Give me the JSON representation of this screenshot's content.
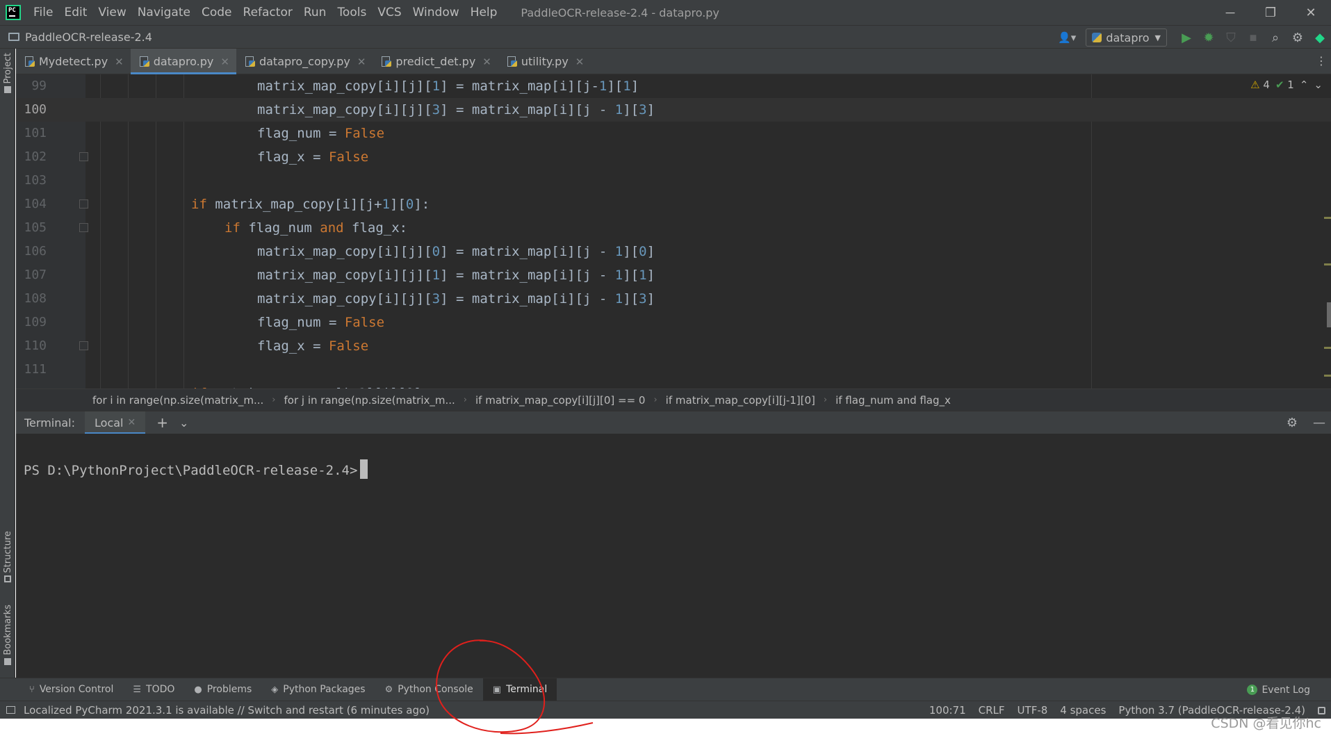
{
  "window": {
    "title": "PaddleOCR-release-2.4 - datapro.py",
    "menu": [
      "File",
      "Edit",
      "View",
      "Navigate",
      "Code",
      "Refactor",
      "Run",
      "Tools",
      "VCS",
      "Window",
      "Help"
    ],
    "controls": {
      "minimize": "─",
      "restore": "❐",
      "close": "✕"
    }
  },
  "navbar": {
    "project": "PaddleOCR-release-2.4",
    "run_config": "datapro"
  },
  "left_stripe": {
    "project": "Project",
    "structure": "Structure",
    "bookmarks": "Bookmarks"
  },
  "tabs": [
    {
      "label": "Mydetect.py",
      "active": false
    },
    {
      "label": "datapro.py",
      "active": true
    },
    {
      "label": "datapro_copy.py",
      "active": false
    },
    {
      "label": "predict_det.py",
      "active": false
    },
    {
      "label": "utility.py",
      "active": false
    }
  ],
  "editor": {
    "inspection": {
      "warnings": "4",
      "ok": "1"
    },
    "current_line": "100",
    "lines": [
      {
        "num": "99",
        "text": "matrix_map_copy[i][j][1] = matrix_map[i][j-1][1]"
      },
      {
        "num": "100",
        "text": "matrix_map_copy[i][j][3] = matrix_map[i][j - 1][3]"
      },
      {
        "num": "101",
        "text": "flag_num = False"
      },
      {
        "num": "102",
        "text": "flag_x = False"
      },
      {
        "num": "103",
        "text": ""
      },
      {
        "num": "104",
        "text": "if matrix_map_copy[i][j+1][0]:"
      },
      {
        "num": "105",
        "text": "if flag_num and flag_x:"
      },
      {
        "num": "106",
        "text": "matrix_map_copy[i][j][0] = matrix_map[i][j - 1][0]"
      },
      {
        "num": "107",
        "text": "matrix_map_copy[i][j][1] = matrix_map[i][j - 1][1]"
      },
      {
        "num": "108",
        "text": "matrix_map_copy[i][j][3] = matrix_map[i][j - 1][3]"
      },
      {
        "num": "109",
        "text": "flag_num = False"
      },
      {
        "num": "110",
        "text": "flag_x = False"
      },
      {
        "num": "111",
        "text": ""
      }
    ]
  },
  "breadcrumbs": [
    "for i in range(np.size(matrix_m...",
    "for j in range(np.size(matrix_m...",
    "if matrix_map_copy[i][j][0] == 0",
    "if matrix_map_copy[i][j-1][0]",
    "if flag_num and flag_x"
  ],
  "terminal": {
    "title": "Terminal:",
    "tab": "Local",
    "prompt": "PS D:\\PythonProject\\PaddleOCR-release-2.4>"
  },
  "tool_windows": [
    {
      "label": "Version Control",
      "icon": "version-control-icon",
      "glyph": "⑂"
    },
    {
      "label": "TODO",
      "icon": "todo-icon",
      "glyph": "☰"
    },
    {
      "label": "Problems",
      "icon": "problems-icon",
      "glyph": "●"
    },
    {
      "label": "Python Packages",
      "icon": "packages-icon",
      "glyph": "◈"
    },
    {
      "label": "Python Console",
      "icon": "python-console-icon",
      "glyph": "⚙"
    },
    {
      "label": "Terminal",
      "icon": "terminal-icon",
      "glyph": "▣",
      "active": true
    }
  ],
  "event_log": {
    "label": "Event Log",
    "count": "1"
  },
  "status_bar": {
    "message": "Localized PyCharm 2021.3.1 is available // Switch and restart (6 minutes ago)",
    "position": "100:71",
    "line_sep": "CRLF",
    "encoding": "UTF-8",
    "indent": "4 spaces",
    "interpreter": "Python 3.7 (PaddleOCR-release-2.4)"
  },
  "watermark": "CSDN @看见你hc",
  "colors": {
    "keyword": "#cc7832",
    "number": "#6897bb",
    "annotation": "#e0201c",
    "accent": "#4a88c7"
  }
}
